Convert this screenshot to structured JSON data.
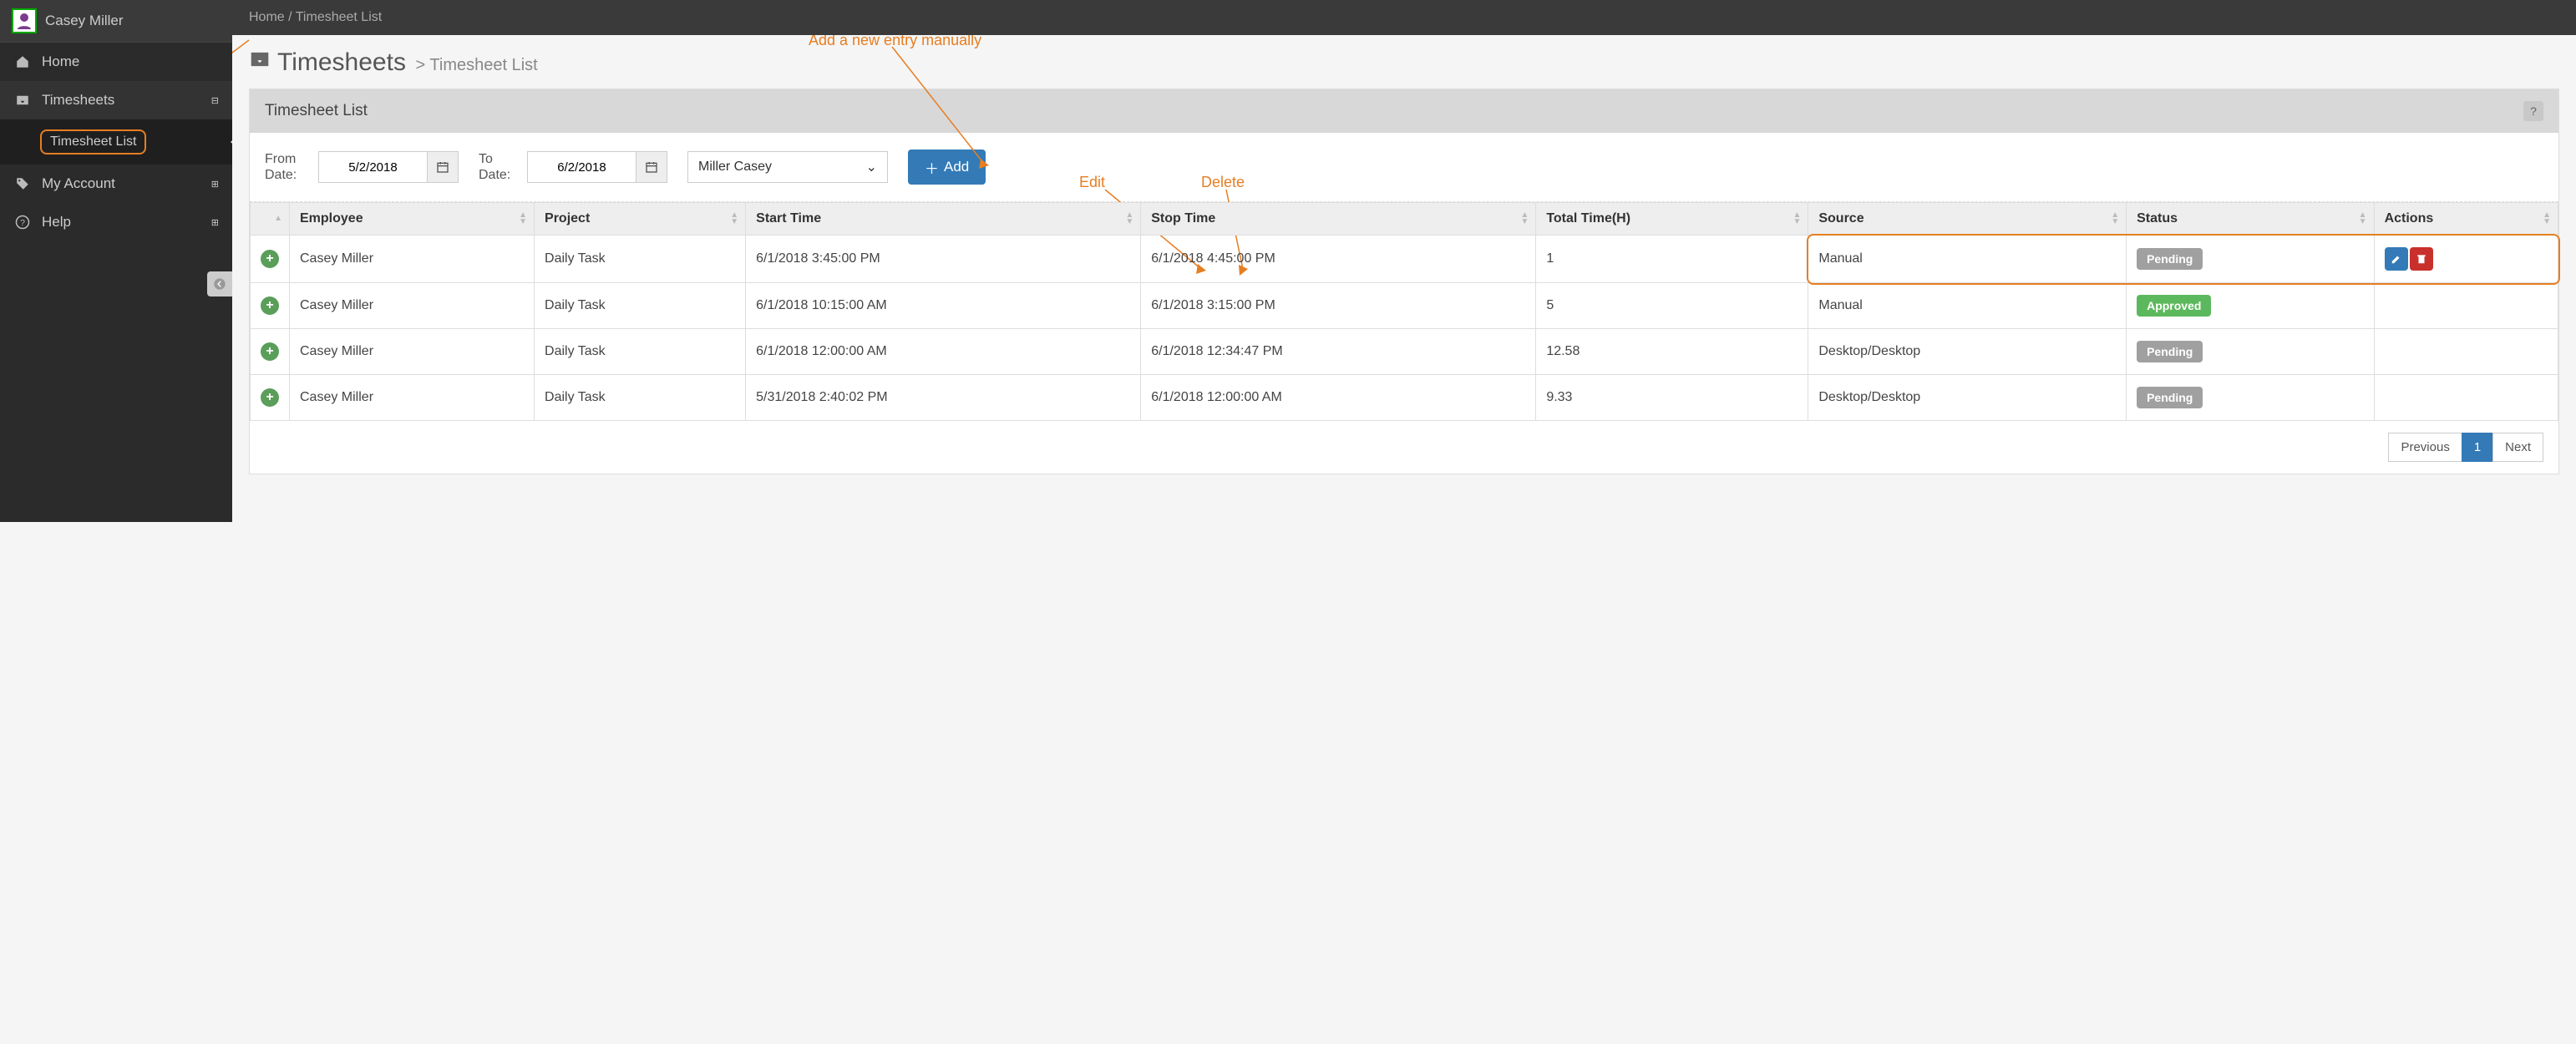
{
  "user": {
    "name": "Casey Miller"
  },
  "sidebar": {
    "items": [
      {
        "label": "Home"
      },
      {
        "label": "Timesheets"
      },
      {
        "label": "My Account"
      },
      {
        "label": "Help"
      }
    ],
    "sub": {
      "timesheet_list": "Timesheet List"
    }
  },
  "breadcrumb": {
    "home": "Home",
    "sep": "/",
    "current": "Timesheet List"
  },
  "page": {
    "title": "Timesheets",
    "sub_prefix": ">",
    "sub": "Timesheet List"
  },
  "panel": {
    "title": "Timesheet List"
  },
  "filters": {
    "from_label": "From Date:",
    "to_label": "To Date:",
    "from_value": "5/2/2018",
    "to_value": "6/2/2018",
    "employee_selected": "Miller Casey",
    "add_label": "Add"
  },
  "annotations": {
    "add": "Add a new entry manually",
    "edit": "Edit",
    "delete": "Delete"
  },
  "table": {
    "headers": [
      "",
      "Employee",
      "Project",
      "Start Time",
      "Stop Time",
      "Total Time(H)",
      "Source",
      "Status",
      "Actions"
    ],
    "rows": [
      {
        "employee": "Casey Miller",
        "project": "Daily Task",
        "start": "6/1/2018 3:45:00 PM",
        "stop": "6/1/2018 4:45:00 PM",
        "total": "1",
        "source": "Manual",
        "status": "Pending",
        "status_class": "pending",
        "actions": true
      },
      {
        "employee": "Casey Miller",
        "project": "Daily Task",
        "start": "6/1/2018 10:15:00 AM",
        "stop": "6/1/2018 3:15:00 PM",
        "total": "5",
        "source": "Manual",
        "status": "Approved",
        "status_class": "approved",
        "actions": false
      },
      {
        "employee": "Casey Miller",
        "project": "Daily Task",
        "start": "6/1/2018 12:00:00 AM",
        "stop": "6/1/2018 12:34:47 PM",
        "total": "12.58",
        "source": "Desktop/Desktop",
        "status": "Pending",
        "status_class": "pending",
        "actions": false
      },
      {
        "employee": "Casey Miller",
        "project": "Daily Task",
        "start": "5/31/2018 2:40:02 PM",
        "stop": "6/1/2018 12:00:00 AM",
        "total": "9.33",
        "source": "Desktop/Desktop",
        "status": "Pending",
        "status_class": "pending",
        "actions": false
      }
    ]
  },
  "pager": {
    "prev": "Previous",
    "page": "1",
    "next": "Next"
  }
}
